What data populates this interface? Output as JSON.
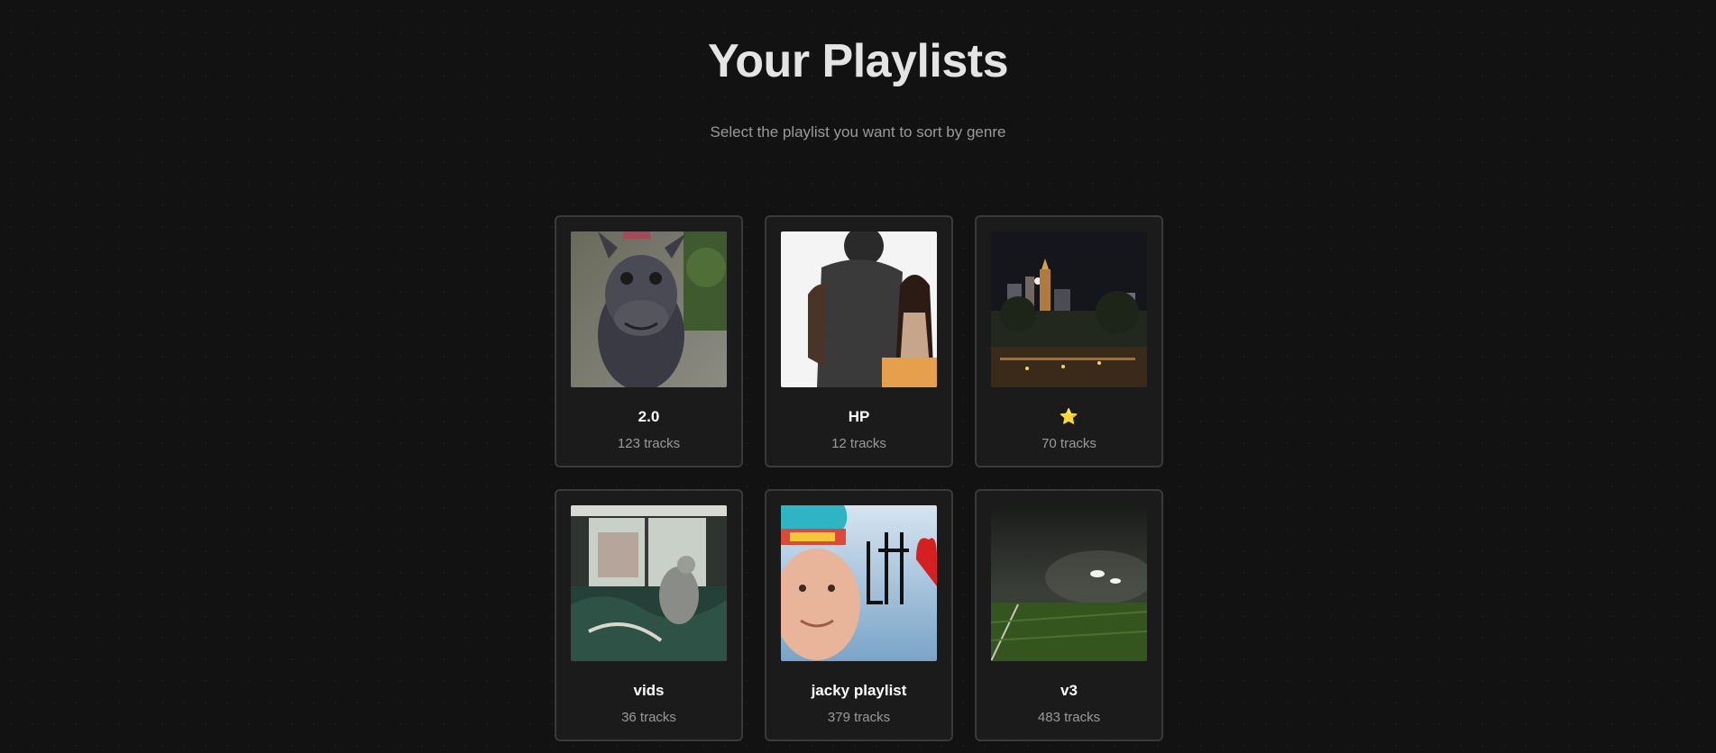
{
  "header": {
    "title": "Your Playlists",
    "subtitle": "Select the playlist you want to sort by genre"
  },
  "playlists": [
    {
      "name": "2.0",
      "tracks": "123 tracks",
      "cover": "donkey-photo"
    },
    {
      "name": "HP",
      "tracks": "12 tracks",
      "cover": "couple-photo"
    },
    {
      "name": "⭐",
      "tracks": "70 tracks",
      "cover": "night-city-photo"
    },
    {
      "name": "vids",
      "tracks": "36 tracks",
      "cover": "kangaroo-window-photo"
    },
    {
      "name": "jacky playlist",
      "tracks": "379 tracks",
      "cover": "blue-hair-portrait-photo"
    },
    {
      "name": "v3",
      "tracks": "483 tracks",
      "cover": "rainy-field-photo"
    }
  ],
  "colors": {
    "background": "#121212",
    "card_background": "#1b1b1b",
    "card_border": "#3a3a3a",
    "muted_text": "#9a9a9a"
  }
}
